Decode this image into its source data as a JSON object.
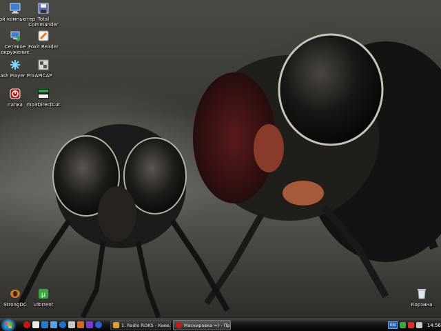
{
  "desktop": {
    "icons": [
      {
        "id": "my-computer",
        "label": "Мой компьютер"
      },
      {
        "id": "total-commander",
        "label": "Total Commander"
      },
      {
        "id": "network",
        "label": "Сетевое окружение"
      },
      {
        "id": "foxit-reader",
        "label": "Foxit Reader"
      },
      {
        "id": "flash-player",
        "label": "Flash Player Pro"
      },
      {
        "id": "apicap",
        "label": "APICAP"
      },
      {
        "id": "folder-papka",
        "label": "папка"
      },
      {
        "id": "mp3directcut",
        "label": "mp3DirectCut"
      },
      {
        "id": "strongdc",
        "label": "StrongDC"
      },
      {
        "id": "utorrent",
        "label": "uTorrent"
      },
      {
        "id": "recycle-bin",
        "label": "Корзина"
      }
    ]
  },
  "taskbar": {
    "tasks": [
      {
        "label": "1. Radio ROKS - Киев...",
        "icon": "winamp-icon"
      },
      {
        "label": "Маскировка =) - Пр...",
        "icon": "opera-icon"
      }
    ],
    "tray": {
      "language": "EN",
      "clock": "14:56"
    }
  },
  "colors": {
    "taskbar": "#0a0a0a",
    "start_orb": "#2a82c4",
    "lang_badge": "#1f5fb8"
  }
}
